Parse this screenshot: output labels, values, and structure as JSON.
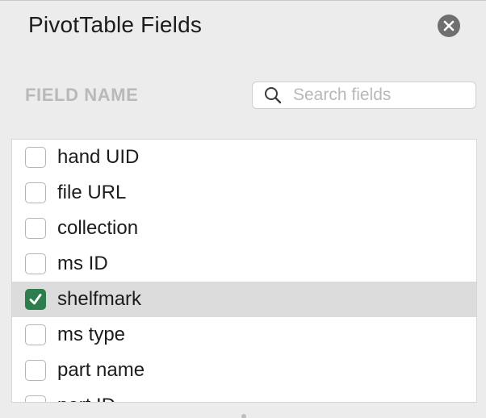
{
  "panel": {
    "title": "PivotTable Fields",
    "close_icon": "close-icon"
  },
  "field_section": {
    "label": "FIELD NAME"
  },
  "search": {
    "placeholder": "Search fields",
    "value": "",
    "icon": "search-icon"
  },
  "fields": [
    {
      "label": "hand UID",
      "checked": false
    },
    {
      "label": "file URL",
      "checked": false
    },
    {
      "label": "collection",
      "checked": false
    },
    {
      "label": "ms ID",
      "checked": false
    },
    {
      "label": "shelfmark",
      "checked": true
    },
    {
      "label": "ms type",
      "checked": false
    },
    {
      "label": "part name",
      "checked": false
    },
    {
      "label": "part ID",
      "checked": false
    }
  ],
  "colors": {
    "checkbox_checked": "#2e7d4f",
    "selected_row": "#dcdcdc",
    "close_button": "#6f6f6f"
  }
}
